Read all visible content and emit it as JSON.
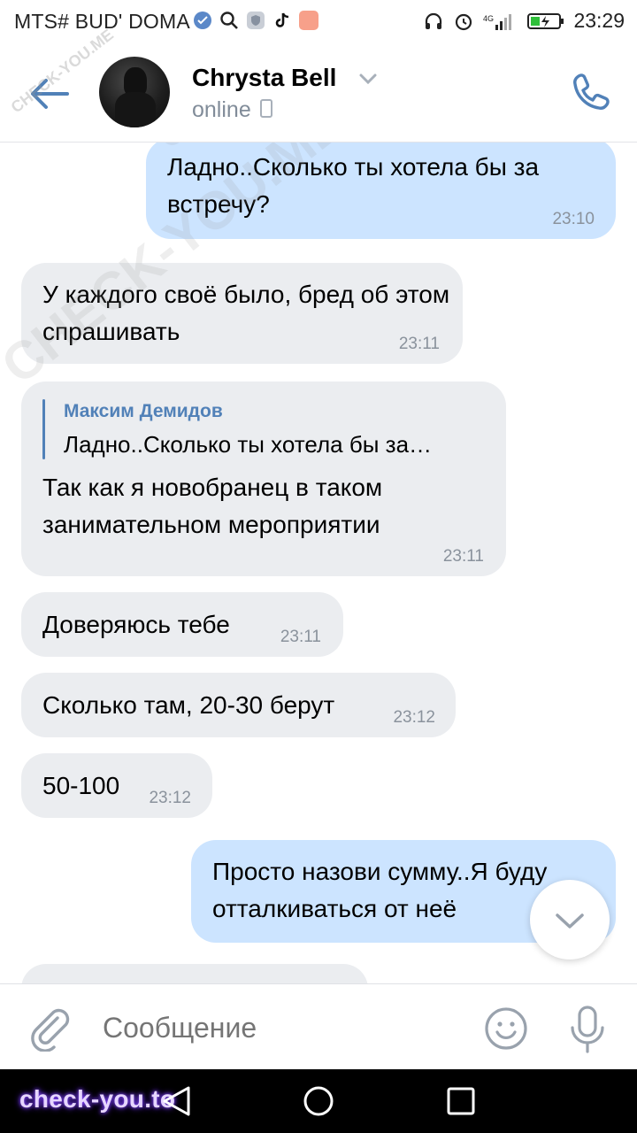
{
  "status_bar": {
    "carrier": "MTS# BUD' DOMA",
    "time": "23:29",
    "icons": [
      "vk-badge-icon",
      "search-icon",
      "shield-app-icon",
      "tiktok-icon",
      "app-icon",
      "headphones-icon",
      "alarm-icon",
      "signal-icon",
      "battery-charging-icon"
    ]
  },
  "header": {
    "contact_name": "Chrysta Bell",
    "status": "online",
    "accent_color": "#5181b8"
  },
  "messages": [
    {
      "direction": "out",
      "text": "Ладно..Сколько ты хотела бы за встречу?",
      "time": "23:10"
    },
    {
      "direction": "in",
      "text": "У каждого своё было, бред об этом спрашивать",
      "time": "23:11"
    },
    {
      "direction": "in",
      "reply_author": "Максим Демидов",
      "reply_text": "Ладно..Сколько ты хотела бы за…",
      "text": "Так как я новобранец в таком занимательном мероприятии",
      "time": "23:11"
    },
    {
      "direction": "in",
      "text": "Доверяюсь тебе",
      "time": "23:11"
    },
    {
      "direction": "in",
      "text": "Сколько там, 20-30 берут",
      "time": "23:12"
    },
    {
      "direction": "in",
      "text": "50-100",
      "time": "23:12"
    },
    {
      "direction": "out",
      "text": "Просто назови сумму..Я буду отталкиваться от неё",
      "time": ""
    }
  ],
  "composer": {
    "placeholder": "Сообщение"
  },
  "watermarks": {
    "diagonal": "CHECK-YOU.ME",
    "small": "CHECK-YOU.ME",
    "bottom": "check-you.to"
  },
  "colors": {
    "outgoing_bubble": "#cce4ff",
    "incoming_bubble": "#ebedf0",
    "link_blue": "#5181b8"
  }
}
